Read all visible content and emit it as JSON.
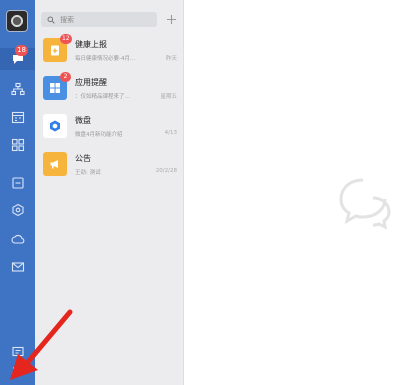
{
  "search": {
    "placeholder": "搜索"
  },
  "rail": {
    "messages_badge": "18"
  },
  "list": [
    {
      "title": "健康上报",
      "subtitle": "每日健康情况必要-4月…",
      "time": "昨天",
      "badge": "12",
      "color": "#f6b43c",
      "icon": "plus-clipboard-icon"
    },
    {
      "title": "应用提醒",
      "subtitle": "：仅如精品课程来了…",
      "time": "星期五",
      "badge": "2",
      "color": "#4a90e2",
      "icon": "grid-apps-icon"
    },
    {
      "title": "微盘",
      "subtitle": "微盘4月新功能介绍",
      "time": "4/13",
      "badge": "",
      "color": "#ffffff",
      "icon": "cloud-drive-icon"
    },
    {
      "title": "公告",
      "subtitle": "王劲: 测试",
      "time": "20/2/28",
      "badge": "",
      "color": "#f6b43c",
      "icon": "megaphone-icon"
    }
  ],
  "colors": {
    "rail": "#3f73c4",
    "annotation_arrow": "#e5261f"
  }
}
